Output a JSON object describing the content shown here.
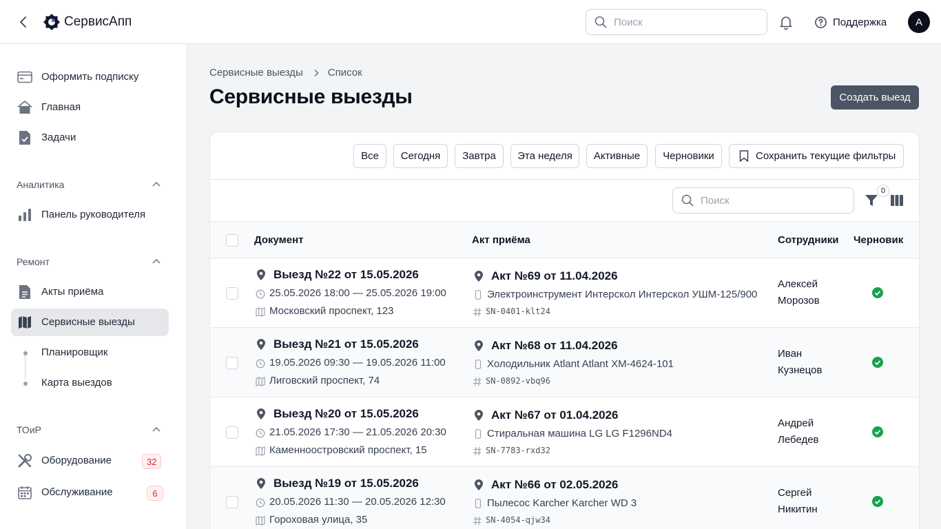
{
  "header": {
    "app_name": "СервисАпп",
    "search_placeholder": "Поиск",
    "support_label": "Поддержка",
    "avatar_letter": "A"
  },
  "sidebar": {
    "top_items": [
      {
        "label": "Оформить подписку",
        "icon": "credit-card-icon"
      },
      {
        "label": "Главная",
        "icon": "home-icon"
      },
      {
        "label": "Задачи",
        "icon": "task-document-icon"
      }
    ],
    "analytics": {
      "title": "Аналитика",
      "items": [
        {
          "label": "Панель руководителя",
          "icon": "bar-chart-icon"
        }
      ]
    },
    "repair": {
      "title": "Ремонт",
      "items": [
        {
          "label": "Акты приёма",
          "icon": "document-icon"
        },
        {
          "label": "Сервисные выезды",
          "icon": "map-icon",
          "active": true
        }
      ],
      "subitems": [
        {
          "label": "Планировщик"
        },
        {
          "label": "Карта выездов"
        }
      ]
    },
    "toir": {
      "title": "ТОиР",
      "items": [
        {
          "label": "Оборудование",
          "icon": "tools-icon",
          "badge": "32"
        },
        {
          "label": "Обслуживание",
          "icon": "calendar-icon",
          "badge": "6"
        }
      ]
    }
  },
  "breadcrumbs": [
    "Сервисные выезды",
    "Список"
  ],
  "page": {
    "title": "Сервисные выезды",
    "create_button": "Создать выезд"
  },
  "filters": {
    "chips": [
      "Все",
      "Сегодня",
      "Завтра",
      "Эта неделя",
      "Активные",
      "Черновики"
    ],
    "save_label": "Сохранить текущие фильтры",
    "search_placeholder": "Поиск",
    "active_filter_count": "0"
  },
  "table": {
    "columns": [
      "Документ",
      "Акт приёма",
      "Сотрудники",
      "Черновик"
    ],
    "rows": [
      {
        "doc": "Выезд №22 от 15.05.2026",
        "time": "25.05.2026 18:00 — 25.05.2026 19:00",
        "address": "Московский проспект, 123",
        "act": "Акт №69 от 11.04.2026",
        "device": "Электроинструмент Интерскол Интерскол УШМ-125/900",
        "serial": "SN-0401-klt24",
        "emp_first": "Алексей",
        "emp_last": "Морозов",
        "draft": true
      },
      {
        "doc": "Выезд №21 от 15.05.2026",
        "time": "19.05.2026 09:30 — 19.05.2026 11:00",
        "address": "Лиговский проспект, 74",
        "act": "Акт №68 от 11.04.2026",
        "device": "Холодильник Atlant Atlant ХМ-4624-101",
        "serial": "SN-0892-vbq96",
        "emp_first": "Иван",
        "emp_last": "Кузнецов",
        "draft": true
      },
      {
        "doc": "Выезд №20 от 15.05.2026",
        "time": "21.05.2026 17:30 — 21.05.2026 20:30",
        "address": "Каменноостровский проспект, 15",
        "act": "Акт №67 от 01.04.2026",
        "device": "Стиральная машина LG LG F1296ND4",
        "serial": "SN-7783-rxd32",
        "emp_first": "Андрей",
        "emp_last": "Лебедев",
        "draft": true
      },
      {
        "doc": "Выезд №19 от 15.05.2026",
        "time": "20.05.2026 11:30 — 20.05.2026 12:30",
        "address": "Гороховая улица, 35",
        "act": "Акт №66 от 02.05.2026",
        "device": "Пылесос Karcher Karcher WD 3",
        "serial": "SN-4054-qjw34",
        "emp_first": "Сергей",
        "emp_last": "Никитин",
        "draft": true
      }
    ]
  },
  "colors": {
    "primary_button": "#4b5563",
    "active_nav_bg": "#e5e7eb",
    "success": "#16a34a",
    "badge_red": "#dc2626"
  }
}
